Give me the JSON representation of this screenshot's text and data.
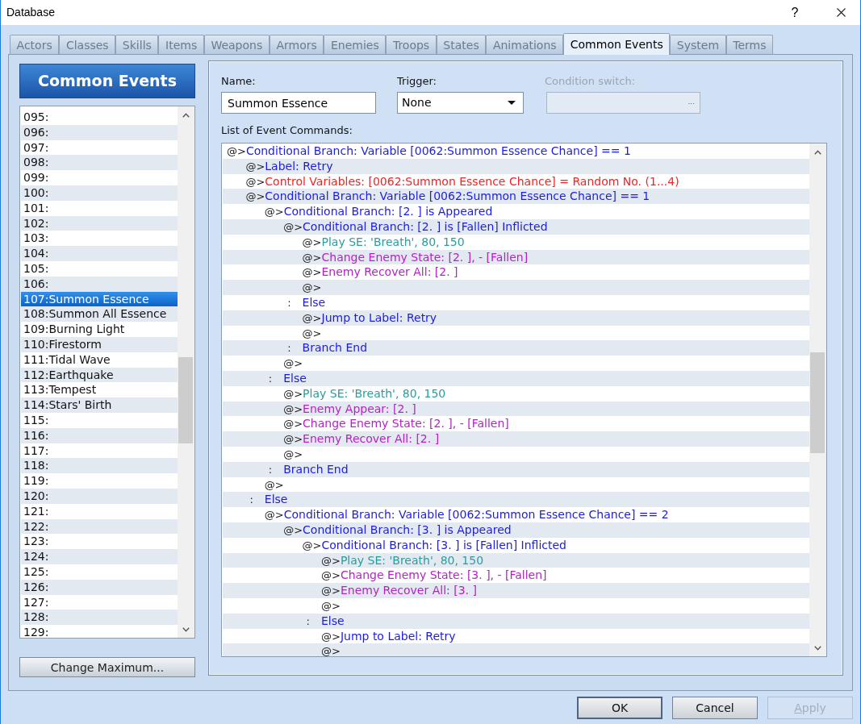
{
  "window": {
    "title": "Database",
    "help_button": "?"
  },
  "tabs": [
    {
      "label": "Actors",
      "selected": false
    },
    {
      "label": "Classes",
      "selected": false
    },
    {
      "label": "Skills",
      "selected": false
    },
    {
      "label": "Items",
      "selected": false
    },
    {
      "label": "Weapons",
      "selected": false
    },
    {
      "label": "Armors",
      "selected": false
    },
    {
      "label": "Enemies",
      "selected": false
    },
    {
      "label": "Troops",
      "selected": false
    },
    {
      "label": "States",
      "selected": false
    },
    {
      "label": "Animations",
      "selected": false
    },
    {
      "label": "Common Events",
      "selected": true
    },
    {
      "label": "System",
      "selected": false
    },
    {
      "label": "Terms",
      "selected": false
    }
  ],
  "sidebar": {
    "title": "Common Events",
    "items": [
      {
        "label": "095:",
        "selected": false
      },
      {
        "label": "096:",
        "selected": false
      },
      {
        "label": "097:",
        "selected": false
      },
      {
        "label": "098:",
        "selected": false
      },
      {
        "label": "099:",
        "selected": false
      },
      {
        "label": "100:",
        "selected": false
      },
      {
        "label": "101:",
        "selected": false
      },
      {
        "label": "102:",
        "selected": false
      },
      {
        "label": "103:",
        "selected": false
      },
      {
        "label": "104:",
        "selected": false
      },
      {
        "label": "105:",
        "selected": false
      },
      {
        "label": "106:",
        "selected": false
      },
      {
        "label": "107:Summon Essence",
        "selected": true
      },
      {
        "label": "108:Summon All Essence",
        "selected": false
      },
      {
        "label": "109:Burning Light",
        "selected": false
      },
      {
        "label": "110:Firestorm",
        "selected": false
      },
      {
        "label": "111:Tidal Wave",
        "selected": false
      },
      {
        "label": "112:Earthquake",
        "selected": false
      },
      {
        "label": "113:Tempest",
        "selected": false
      },
      {
        "label": "114:Stars' Birth",
        "selected": false
      },
      {
        "label": "115:",
        "selected": false
      },
      {
        "label": "116:",
        "selected": false
      },
      {
        "label": "117:",
        "selected": false
      },
      {
        "label": "118:",
        "selected": false
      },
      {
        "label": "119:",
        "selected": false
      },
      {
        "label": "120:",
        "selected": false
      },
      {
        "label": "121:",
        "selected": false
      },
      {
        "label": "122:",
        "selected": false
      },
      {
        "label": "123:",
        "selected": false
      },
      {
        "label": "124:",
        "selected": false
      },
      {
        "label": "125:",
        "selected": false
      },
      {
        "label": "126:",
        "selected": false
      },
      {
        "label": "127:",
        "selected": false
      },
      {
        "label": "128:",
        "selected": false
      },
      {
        "label": "129:",
        "selected": false
      }
    ],
    "button": "Change Maximum..."
  },
  "editor": {
    "name": {
      "label": "Name:",
      "value": "Summon Essence"
    },
    "trigger": {
      "label": "Trigger:",
      "value": "None"
    },
    "condition_switch": {
      "label": "Condition switch:",
      "button_label": "...",
      "disabled": true
    },
    "commands_label": "List of Event Commands:",
    "commands": [
      {
        "marker": "@>",
        "kind": "flow",
        "text": "Conditional Branch: Variable [0062:Summon Essence Chance] == 1",
        "children": [
          {
            "marker": "@>",
            "kind": "flow",
            "text": "Label: Retry"
          },
          {
            "marker": "@>",
            "kind": "variable",
            "text": "Control Variables: [0062:Summon Essence Chance] = Random No. (1...4)"
          },
          {
            "marker": "@>",
            "kind": "flow",
            "text": "Conditional Branch: Variable [0062:Summon Essence Chance] == 1",
            "children": [
              {
                "marker": "@>",
                "kind": "flow",
                "text": "Conditional Branch: [2. ] is Appeared",
                "children": [
                  {
                    "marker": "@>",
                    "kind": "flow",
                    "text": "Conditional Branch: [2. ] is [Fallen] Inflicted",
                    "children": [
                      {
                        "marker": "@>",
                        "kind": "audio",
                        "text": "Play SE: 'Breath', 80, 150"
                      },
                      {
                        "marker": "@>",
                        "kind": "enemy",
                        "text": "Change Enemy State: [2. ], - [Fallen]"
                      },
                      {
                        "marker": "@>",
                        "kind": "enemy",
                        "text": "Enemy Recover All: [2. ]"
                      },
                      {
                        "marker": "@>",
                        "kind": "empty"
                      }
                    ]
                  },
                  {
                    "marker": ":",
                    "kind": "section",
                    "text": "Else",
                    "children": [
                      {
                        "marker": "@>",
                        "kind": "flow",
                        "text": "Jump to Label: Retry"
                      },
                      {
                        "marker": "@>",
                        "kind": "empty"
                      }
                    ]
                  },
                  {
                    "marker": ":",
                    "kind": "section",
                    "text": "Branch End"
                  },
                  {
                    "marker": "@>",
                    "kind": "empty"
                  }
                ]
              },
              {
                "marker": ":",
                "kind": "section",
                "text": "Else",
                "children": [
                  {
                    "marker": "@>",
                    "kind": "audio",
                    "text": "Play SE: 'Breath', 80, 150"
                  },
                  {
                    "marker": "@>",
                    "kind": "enemy",
                    "text": "Enemy Appear: [2. ]"
                  },
                  {
                    "marker": "@>",
                    "kind": "enemy",
                    "text": "Change Enemy State: [2. ], - [Fallen]"
                  },
                  {
                    "marker": "@>",
                    "kind": "enemy",
                    "text": "Enemy Recover All: [2. ]"
                  },
                  {
                    "marker": "@>",
                    "kind": "empty"
                  }
                ]
              },
              {
                "marker": ":",
                "kind": "section",
                "text": "Branch End"
              },
              {
                "marker": "@>",
                "kind": "empty"
              }
            ]
          },
          {
            "marker": ":",
            "kind": "section",
            "text": "Else",
            "children": [
              {
                "marker": "@>",
                "kind": "flow",
                "text": "Conditional Branch: Variable [0062:Summon Essence Chance] == 2",
                "children": [
                  {
                    "marker": "@>",
                    "kind": "flow",
                    "text": "Conditional Branch: [3. ] is Appeared",
                    "children": [
                      {
                        "marker": "@>",
                        "kind": "flow",
                        "text": "Conditional Branch: [3. ] is [Fallen] Inflicted",
                        "children": [
                          {
                            "marker": "@>",
                            "kind": "audio",
                            "text": "Play SE: 'Breath', 80, 150"
                          },
                          {
                            "marker": "@>",
                            "kind": "enemy",
                            "text": "Change Enemy State: [3. ], - [Fallen]"
                          },
                          {
                            "marker": "@>",
                            "kind": "enemy",
                            "text": "Enemy Recover All: [3. ]"
                          },
                          {
                            "marker": "@>",
                            "kind": "empty"
                          }
                        ]
                      },
                      {
                        "marker": ":",
                        "kind": "section",
                        "text": "Else",
                        "children": [
                          {
                            "marker": "@>",
                            "kind": "flow",
                            "text": "Jump to Label: Retry"
                          },
                          {
                            "marker": "@>",
                            "kind": "empty"
                          }
                        ]
                      }
                    ]
                  }
                ]
              }
            ]
          }
        ]
      }
    ]
  },
  "buttons": [
    {
      "label": "OK",
      "default": true,
      "disabled": false,
      "mnemonic": false
    },
    {
      "label": "Cancel",
      "default": false,
      "disabled": false,
      "mnemonic": false
    },
    {
      "label": "Apply",
      "default": false,
      "disabled": true,
      "mnemonic": true
    }
  ]
}
